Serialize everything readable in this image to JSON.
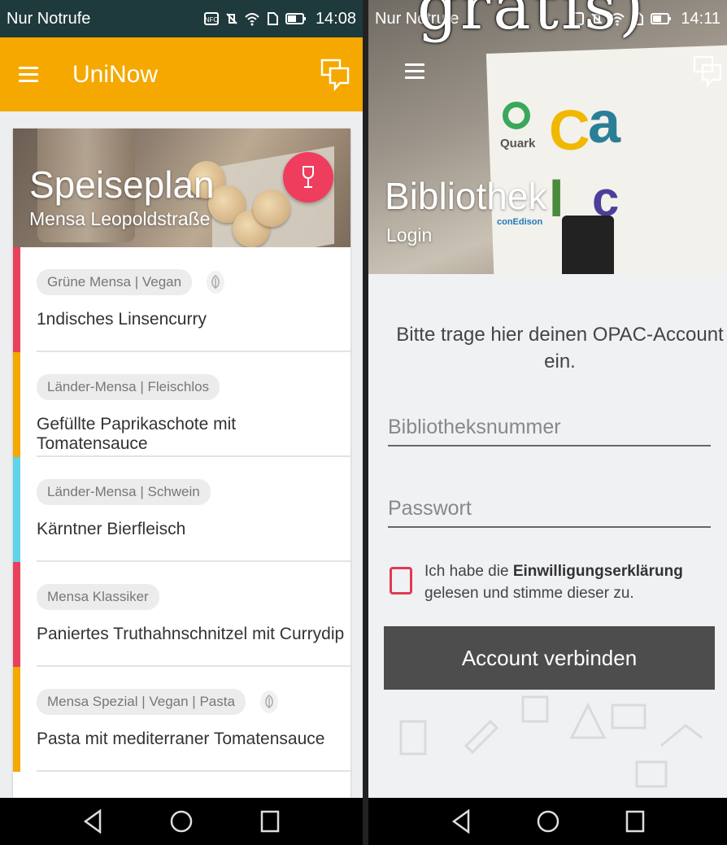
{
  "watermark": "gratis)",
  "left": {
    "status": {
      "carrier": "Nur Notrufe",
      "time": "14:08"
    },
    "appbar": {
      "title": "UniNow"
    },
    "card": {
      "title": "Speiseplan",
      "subtitle": "Mensa Leopoldstraße",
      "items": [
        {
          "tag": "Grüne Mensa | Vegan",
          "dish": "1ndisches Linsencurry",
          "stripe": "#e8415c",
          "leaf": true
        },
        {
          "tag": "Länder-Mensa | Fleischlos",
          "dish": "Gefüllte Paprikaschote mit Tomatensauce",
          "stripe": "#f4a800",
          "leaf": false
        },
        {
          "tag": "Länder-Mensa | Schwein",
          "dish": "Kärntner Bierfleisch",
          "stripe": "#5fd3e8",
          "leaf": false
        },
        {
          "tag": "Mensa Klassiker",
          "dish": "Paniertes Truthahnschnitzel mit Currydip",
          "stripe": "#e8415c",
          "leaf": false
        },
        {
          "tag": "Mensa Spezial | Vegan | Pasta",
          "dish": "Pasta mit mediterraner Tomatensauce",
          "stripe": "#f4a800",
          "leaf": true
        }
      ]
    }
  },
  "right": {
    "status": {
      "carrier": "Nur Notrufe",
      "time": "14:11"
    },
    "hero": {
      "title": "Bibliothek",
      "subtitle": "Login",
      "logo_text_1": "Quark",
      "logo_text_2": "conEdison"
    },
    "login": {
      "prompt": "Bitte trage hier deinen OPAC-Account ein.",
      "library_number_placeholder": "Bibliotheksnummer",
      "password_placeholder": "Passwort",
      "consent_prefix": "Ich habe die ",
      "consent_bold": "Einwilligungserklärung",
      "consent_suffix": " gelesen und stimme dieser zu.",
      "button": "Account verbinden"
    }
  },
  "colors": {
    "accent": "#f4a800",
    "fab": "#ef3d5e",
    "button": "#4d4d4d",
    "checkbox": "#e03a55"
  }
}
